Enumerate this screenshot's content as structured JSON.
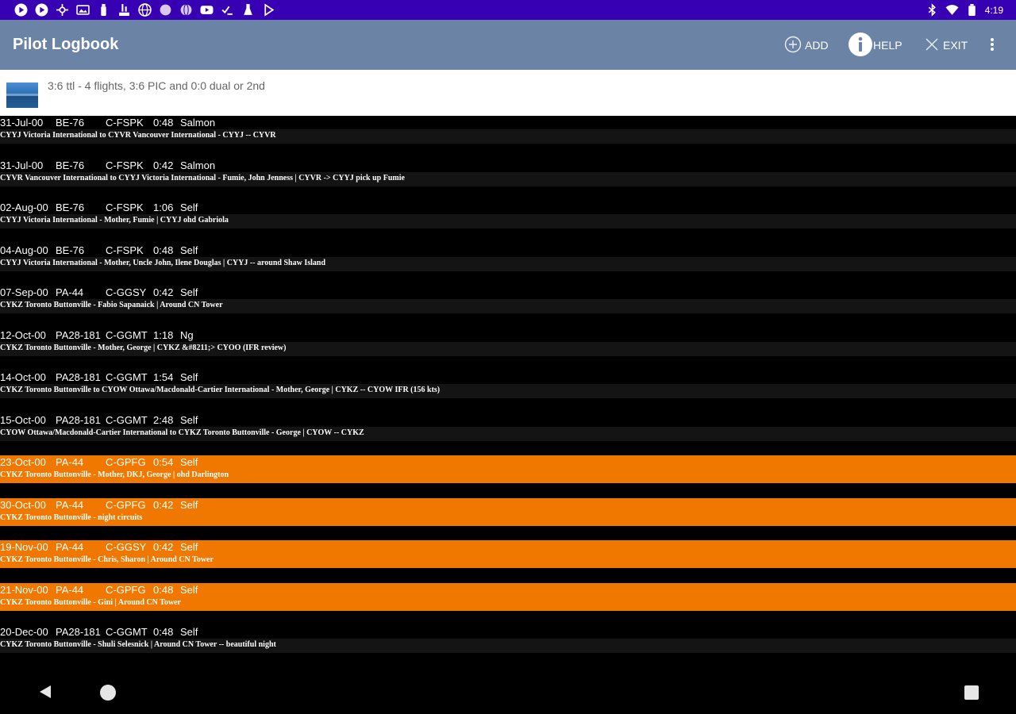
{
  "status_bar": {
    "time": "4:19",
    "left_icons": [
      "play-circle-icon",
      "play-circle-icon",
      "network-icon",
      "gallery-icon",
      "bottle-icon",
      "lab-icon",
      "globe-icon",
      "circle-icon",
      "globe-icon",
      "youtube-icon",
      "checklist-icon",
      "flask-icon",
      "play-icon"
    ],
    "right_icons": [
      "bluetooth-icon",
      "wifi-icon",
      "battery-icon"
    ]
  },
  "app_bar": {
    "title": "Pilot Logbook",
    "add_label": "ADD",
    "help_label": "HELP",
    "exit_label": "EXIT"
  },
  "summary": {
    "text": "3:6 ttl - 4  flights, 3:6 PIC and 0:0 dual or 2nd"
  },
  "colors": {
    "status_bar": "#3700b3",
    "app_bar": "#6b84a6",
    "highlight": "#f07800",
    "row_detail_bg": "#141414"
  },
  "flights": [
    {
      "date": "31-Jul-00",
      "type": "BE-76",
      "reg": "C-FSPK",
      "duration": "0:48",
      "pic": "Salmon",
      "detail": "CYYJ Victoria International to CYVR Vancouver International - CYYJ -- CYVR",
      "highlighted": false
    },
    {
      "date": "31-Jul-00",
      "type": "BE-76",
      "reg": "C-FSPK",
      "duration": "0:42",
      "pic": "Salmon",
      "detail": "CYVR Vancouver International to CYYJ Victoria International - Fumie, John Jenness | CYVR -> CYYJ pick up Fumie",
      "highlighted": false
    },
    {
      "date": "02-Aug-00",
      "type": "BE-76",
      "reg": "C-FSPK",
      "duration": "1:06",
      "pic": "Self",
      "detail": "CYYJ Victoria International - Mother, Fumie | CYYJ ohd Gabriola",
      "highlighted": false
    },
    {
      "date": "04-Aug-00",
      "type": "BE-76",
      "reg": "C-FSPK",
      "duration": "0:48",
      "pic": "Self",
      "detail": "CYYJ Victoria International - Mother, Uncle John, Ilene Douglas | CYYJ -- around Shaw Island",
      "highlighted": false
    },
    {
      "date": "07-Sep-00",
      "type": "PA-44",
      "reg": "C-GGSY",
      "duration": "0:42",
      "pic": "Self",
      "detail": "CYKZ Toronto Buttonville - Fabio Sapanaick | Around CN Tower",
      "highlighted": false
    },
    {
      "date": "12-Oct-00",
      "type": "PA28-181",
      "reg": "C-GGMT",
      "duration": "1:18",
      "pic": "Ng",
      "detail": "CYKZ Toronto Buttonville - Mother, George | CYKZ &#8211;> CYOO (IFR review)",
      "highlighted": false
    },
    {
      "date": "14-Oct-00",
      "type": "PA28-181",
      "reg": "C-GGMT",
      "duration": "1:54",
      "pic": "Self",
      "detail": "CYKZ Toronto Buttonville to CYOW Ottawa/Macdonald-Cartier International - Mother, George | CYKZ -- CYOW IFR (156 kts)",
      "highlighted": false
    },
    {
      "date": "15-Oct-00",
      "type": "PA28-181",
      "reg": "C-GGMT",
      "duration": "2:48",
      "pic": "Self",
      "detail": "CYOW Ottawa/Macdonald-Cartier International to CYKZ Toronto Buttonville - George | CYOW -- CYKZ",
      "highlighted": false
    },
    {
      "date": "23-Oct-00",
      "type": "PA-44",
      "reg": "C-GPFG",
      "duration": "0:54",
      "pic": "Self",
      "detail": "CYKZ Toronto Buttonville - Mother, DKJ, George | ohd Darlington",
      "highlighted": true
    },
    {
      "date": "30-Oct-00",
      "type": "PA-44",
      "reg": "C-GPFG",
      "duration": "0:42",
      "pic": "Self",
      "detail": "CYKZ Toronto Buttonville - night circuits",
      "highlighted": true
    },
    {
      "date": "19-Nov-00",
      "type": "PA-44",
      "reg": "C-GGSY",
      "duration": "0:42",
      "pic": "Self",
      "detail": "CYKZ Toronto Buttonville - Chris, Sharon | Around CN Tower",
      "highlighted": true
    },
    {
      "date": "21-Nov-00",
      "type": "PA-44",
      "reg": "C-GPFG",
      "duration": "0:48",
      "pic": "Self",
      "detail": "CYKZ Toronto Buttonville - Gini | Around CN Tower",
      "highlighted": true
    },
    {
      "date": "20-Dec-00",
      "type": "PA28-181",
      "reg": "C-GGMT",
      "duration": "0:48",
      "pic": "Self",
      "detail": "CYKZ Toronto Buttonville - Shuli Selesnick | Around CN Tower -- beautiful night",
      "highlighted": false
    }
  ]
}
